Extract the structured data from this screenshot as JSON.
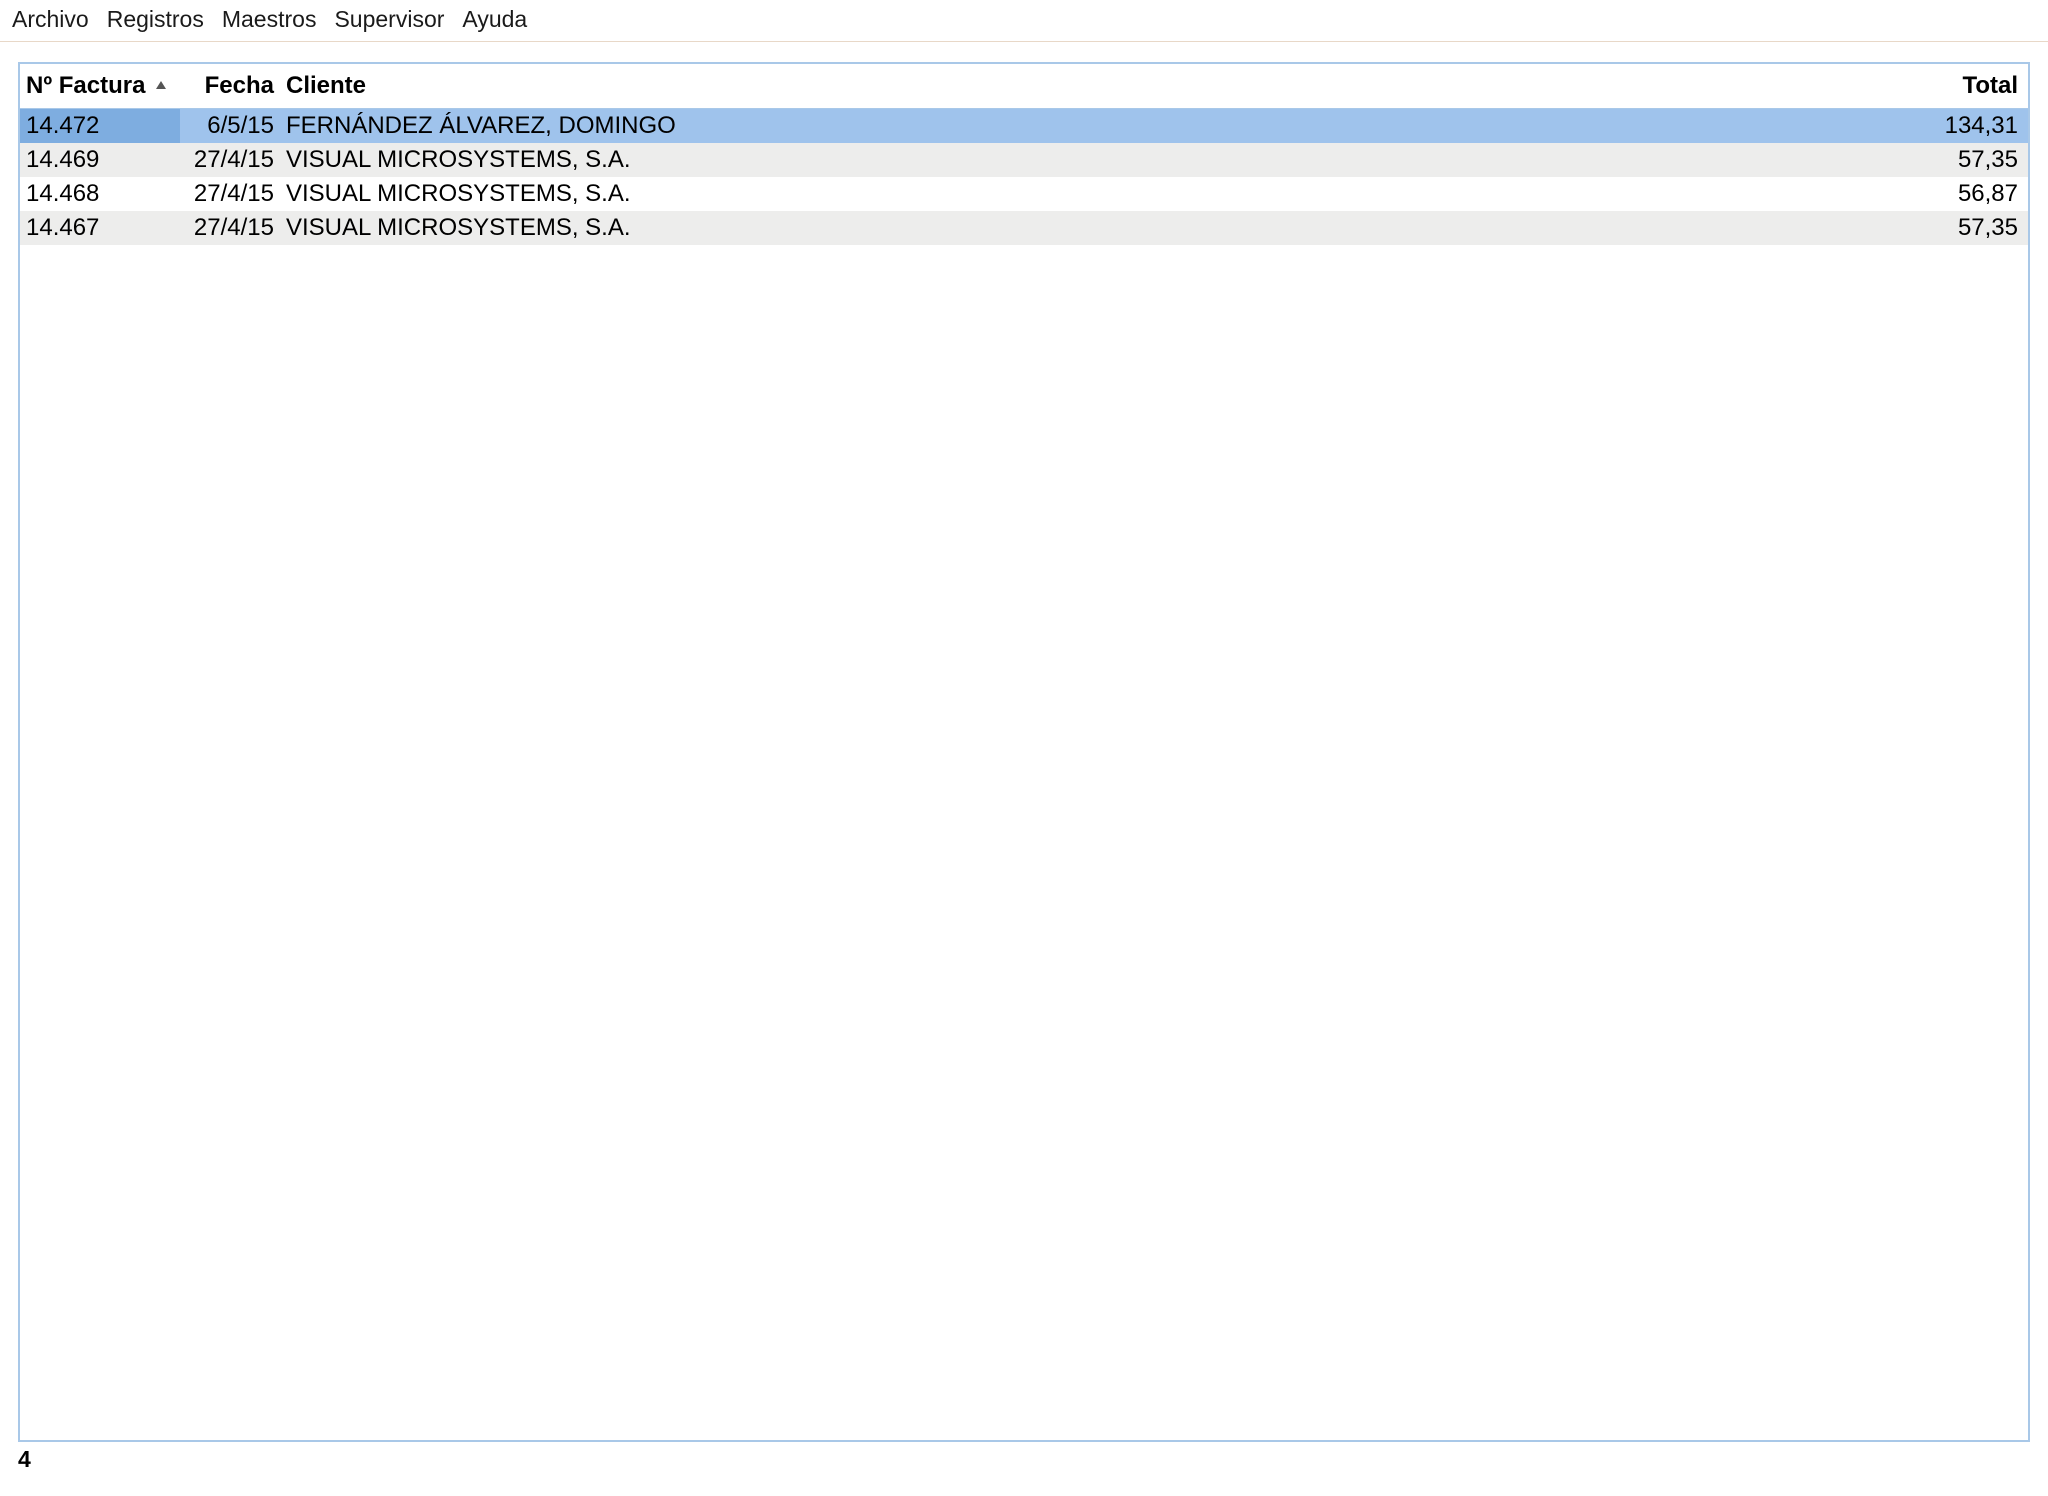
{
  "menubar": {
    "items": [
      "Archivo",
      "Registros",
      "Maestros",
      "Supervisor",
      "Ayuda"
    ]
  },
  "table": {
    "headers": {
      "factura": "Nº Factura",
      "fecha": "Fecha",
      "cliente": "Cliente",
      "total": "Total"
    },
    "sort_column": "factura",
    "sort_dir": "asc",
    "rows": [
      {
        "factura": "14.472",
        "fecha": "6/5/15",
        "cliente": "FERNÁNDEZ ÁLVAREZ, DOMINGO",
        "total": "134,31",
        "selected": true
      },
      {
        "factura": "14.469",
        "fecha": "27/4/15",
        "cliente": "VISUAL MICROSYSTEMS, S.A.",
        "total": "57,35",
        "selected": false
      },
      {
        "factura": "14.468",
        "fecha": "27/4/15",
        "cliente": "VISUAL MICROSYSTEMS, S.A.",
        "total": "56,87",
        "selected": false
      },
      {
        "factura": "14.467",
        "fecha": "27/4/15",
        "cliente": "VISUAL MICROSYSTEMS, S.A.",
        "total": "57,35",
        "selected": false
      }
    ]
  },
  "status": {
    "count": "4"
  }
}
